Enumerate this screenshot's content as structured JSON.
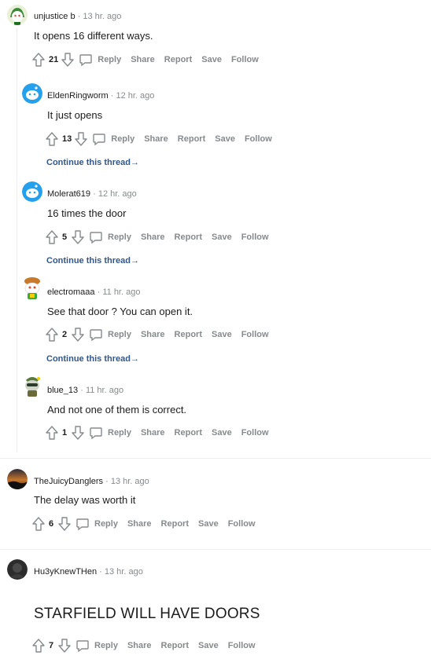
{
  "comments": [
    {
      "user": "unjustice b",
      "time": "13 hr. ago",
      "text": "It opens 16 different ways.",
      "score": "21"
    },
    {
      "user": "EldenRingworm",
      "time": "12 hr. ago",
      "text": "It just opens",
      "score": "13",
      "continue": "Continue this thread"
    },
    {
      "user": "Molerat619",
      "time": "12 hr. ago",
      "text": "16 times the door",
      "score": "5",
      "continue": "Continue this thread"
    },
    {
      "user": "electromaaa",
      "time": "11 hr. ago",
      "text": "See that door ? You can open it.",
      "score": "2",
      "continue": "Continue this thread"
    },
    {
      "user": "blue_13",
      "time": "11 hr. ago",
      "text": "And not one of them is correct.",
      "score": "1"
    },
    {
      "user": "TheJuicyDanglers",
      "time": "13 hr. ago",
      "text": "The delay was worth it",
      "score": "6"
    },
    {
      "user": "Hu3yKnewTHen",
      "time": "13 hr. ago",
      "text": "STARFIELD WILL HAVE DOORS",
      "score": "7"
    }
  ],
  "actions": {
    "reply": "Reply",
    "share": "Share",
    "report": "Report",
    "save": "Save",
    "follow": "Follow"
  },
  "separator": "·",
  "arrow": "→",
  "colors": {
    "link": "#33568a",
    "muted": "#878a8c",
    "text": "#1c1c1c",
    "snoo_blue": "#24a0ed"
  }
}
